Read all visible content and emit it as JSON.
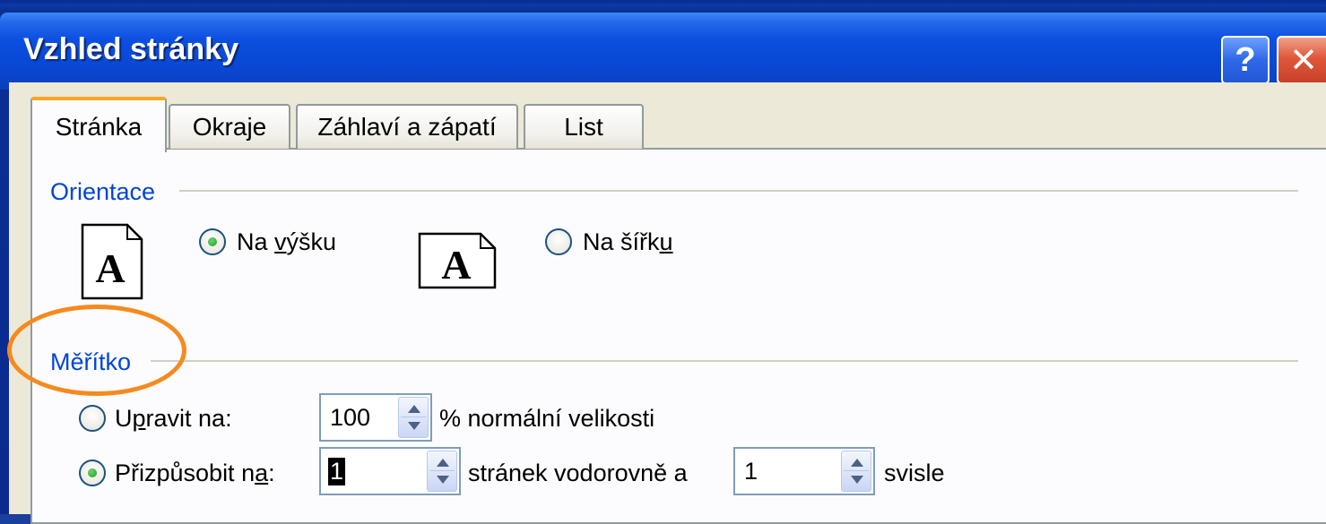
{
  "dialog": {
    "title": "Vzhled stránky",
    "help_glyph": "?",
    "close_glyph": "✕"
  },
  "tabs": [
    {
      "label": "Stránka",
      "active": true
    },
    {
      "label": "Okraje",
      "active": false
    },
    {
      "label": "Záhlaví a zápatí",
      "active": false
    },
    {
      "label": "List",
      "active": false
    }
  ],
  "orientation": {
    "heading": "Orientace",
    "page_glyph": "A",
    "portrait": {
      "pre": "Na ",
      "accel": "v",
      "post": "ýšku",
      "checked": true
    },
    "landscape": {
      "pre": "Na šířk",
      "accel": "u",
      "post": "",
      "checked": false
    }
  },
  "scale": {
    "heading": "Měřítko",
    "adjust": {
      "pre": "U",
      "accel": "p",
      "post": "ravit na:",
      "checked": false,
      "value": "100",
      "suffix": "% normální velikosti"
    },
    "fit": {
      "pre": "Přizpůsobit n",
      "accel": "a",
      "post": ":",
      "checked": true,
      "wide_value": "1",
      "mid_text": "stránek vodorovně a",
      "tall_value": "1",
      "suffix": "svisle"
    }
  },
  "colors": {
    "accent": "#0046d5",
    "title_bar": "#0a47d4",
    "dialog_bg": "#ece9d8",
    "highlight": "#f68a1e"
  },
  "icons": [
    "help-icon",
    "close-icon",
    "portrait-page-icon",
    "landscape-page-icon"
  ]
}
